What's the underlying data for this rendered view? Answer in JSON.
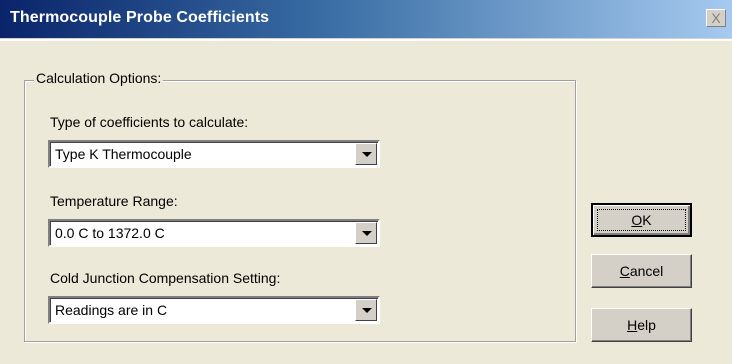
{
  "window": {
    "title": "Thermocouple Probe Coefficients",
    "close_label": "X"
  },
  "options": {
    "group_label": "Calculation Options:",
    "type": {
      "label": "Type of coefficients to calculate:",
      "value": "Type K Thermocouple"
    },
    "range": {
      "label": "Temperature Range:",
      "value": "0.0 C to 1372.0 C"
    },
    "cjc": {
      "label": "Cold Junction Compensation Setting:",
      "value": "Readings are in C"
    }
  },
  "buttons": {
    "ok": {
      "accel": "O",
      "rest": "K"
    },
    "cancel": {
      "accel": "C",
      "rest": "ancel"
    },
    "help": {
      "accel": "H",
      "rest": "elp"
    }
  }
}
